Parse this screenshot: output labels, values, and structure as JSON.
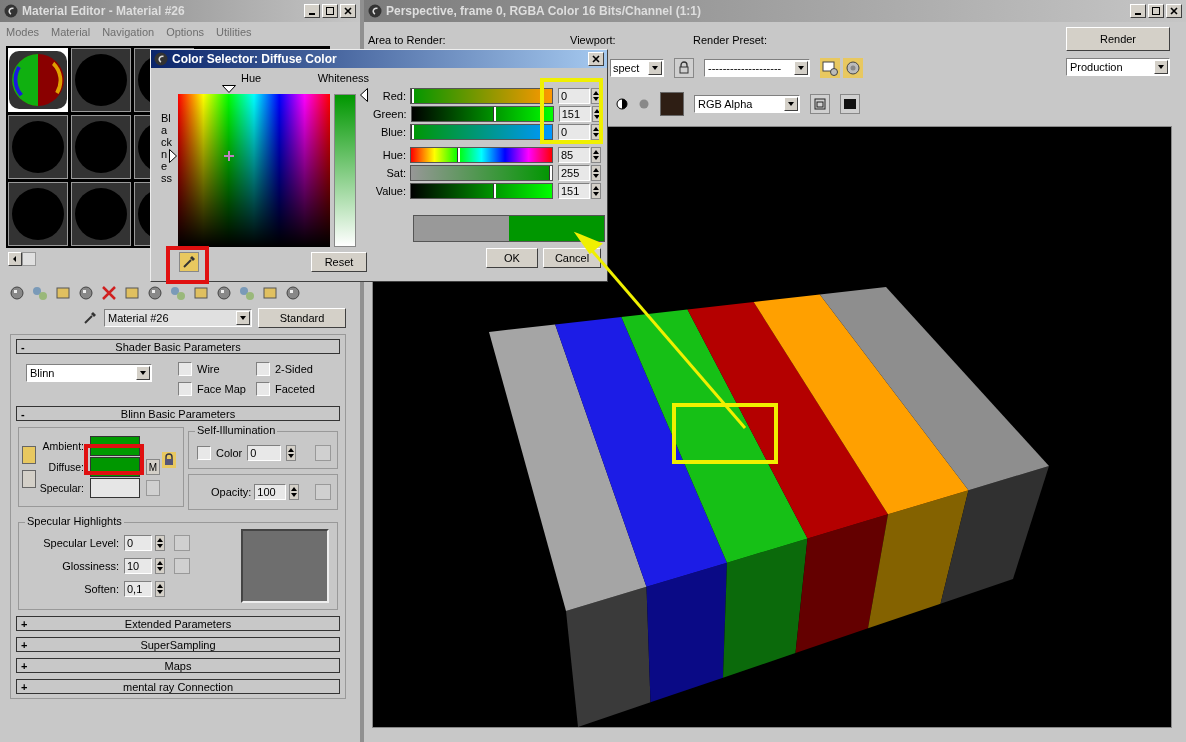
{
  "material_editor": {
    "title": "Material Editor - Material #26",
    "menu": [
      "Modes",
      "Material",
      "Navigation",
      "Options",
      "Utilities"
    ],
    "sample_slots": [
      {
        "selected": true
      },
      {
        "selected": false
      },
      {
        "selected": false
      },
      {
        "selected": false
      },
      {
        "selected": false
      },
      {
        "selected": false
      },
      {
        "selected": false
      },
      {
        "selected": false
      },
      {
        "selected": false
      }
    ],
    "material_name": "Material #26",
    "material_type": "Standard",
    "shader_basic": {
      "sign": "-",
      "title": "Shader Basic Parameters",
      "shader": "Blinn",
      "options": [
        {
          "label": "Wire",
          "checked": false
        },
        {
          "label": "2-Sided",
          "checked": false
        },
        {
          "label": "Face Map",
          "checked": false
        },
        {
          "label": "Faceted",
          "checked": false
        }
      ]
    },
    "blinn_basic": {
      "sign": "-",
      "title": "Blinn Basic Parameters",
      "colors": [
        {
          "label": "Ambient:",
          "color": "#009900"
        },
        {
          "label": "Diffuse:",
          "color": "#009700"
        },
        {
          "label": "Specular:",
          "color": "#e6e6e6"
        }
      ],
      "map_button": "M",
      "self_illumination": {
        "title": "Self-Illumination",
        "label": "Color",
        "checked": false,
        "value": "0"
      },
      "opacity": {
        "label": "Opacity:",
        "value": "100"
      }
    },
    "specular_highlights": {
      "title": "Specular Highlights",
      "fields": [
        {
          "label": "Specular Level:",
          "value": "0"
        },
        {
          "label": "Glossiness:",
          "value": "10"
        },
        {
          "label": "Soften:",
          "value": "0,1"
        }
      ]
    },
    "rollouts": [
      {
        "sign": "+",
        "label": "Extended Parameters"
      },
      {
        "sign": "+",
        "label": "SuperSampling"
      },
      {
        "sign": "+",
        "label": "Maps"
      },
      {
        "sign": "+",
        "label": "mental ray Connection"
      }
    ]
  },
  "color_selector": {
    "title": "Color Selector: Diffuse Color",
    "hue_label": "Hue",
    "whiteness_label": "Whiteness",
    "blackness_label": "Blackness",
    "channels": [
      {
        "kind": "red",
        "label": "Red:",
        "value": "0",
        "level": 0
      },
      {
        "kind": "green",
        "label": "Green:",
        "value": "151",
        "level": 0.592
      },
      {
        "kind": "blue",
        "label": "Blue:",
        "value": "0",
        "level": 0
      },
      {
        "kind": "hue",
        "label": "Hue:",
        "value": "85",
        "level": 0.333
      },
      {
        "kind": "sat",
        "label": "Sat:",
        "value": "255",
        "level": 1
      },
      {
        "kind": "value",
        "label": "Value:",
        "value": "151",
        "level": 0.592
      }
    ],
    "reset": "Reset",
    "ok": "OK",
    "cancel": "Cancel"
  },
  "render_window": {
    "title": "Perspective, frame 0, RGBA Color 16 Bits/Channel (1:1)",
    "area_label": "Area to Render:",
    "viewport_label": "Viewport:",
    "viewport_value": "spect",
    "preset_label": "Render Preset:",
    "preset_value": "--------------------",
    "render_button": "Render",
    "mode_value": "Production",
    "channel_value": "RGB Alpha"
  }
}
